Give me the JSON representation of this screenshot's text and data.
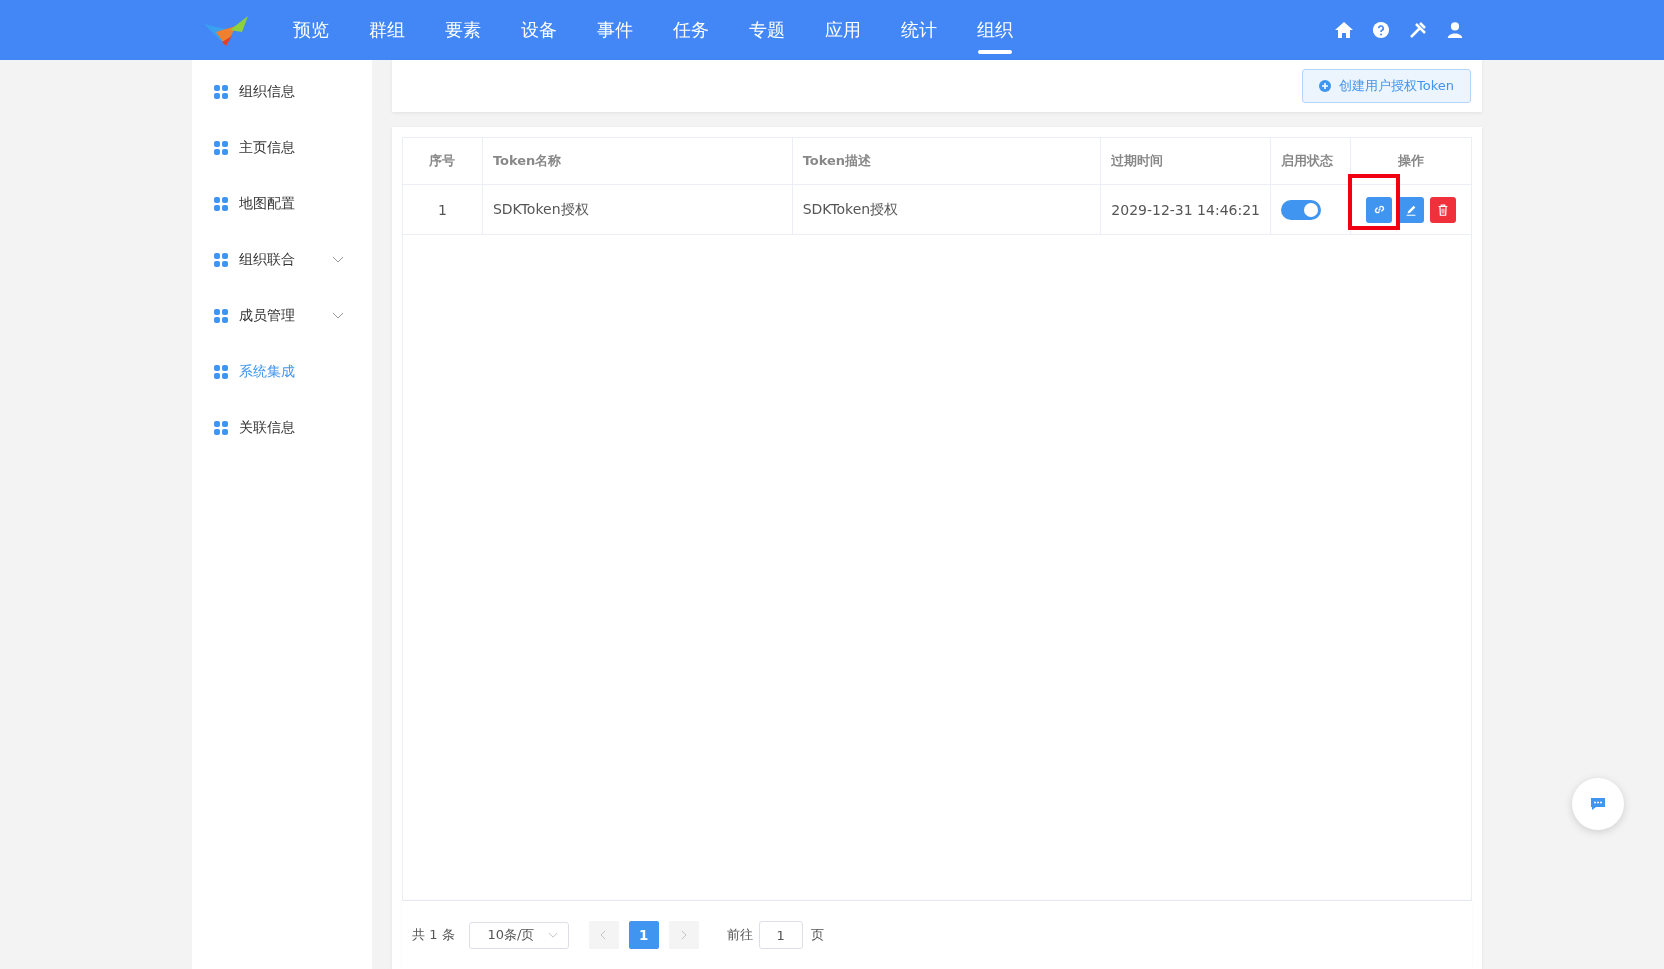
{
  "nav": {
    "tabs": [
      {
        "label": "预览",
        "selected": false
      },
      {
        "label": "群组",
        "selected": false
      },
      {
        "label": "要素",
        "selected": false
      },
      {
        "label": "设备",
        "selected": false
      },
      {
        "label": "事件",
        "selected": false
      },
      {
        "label": "任务",
        "selected": false
      },
      {
        "label": "专题",
        "selected": false
      },
      {
        "label": "应用",
        "selected": false
      },
      {
        "label": "统计",
        "selected": false
      },
      {
        "label": "组织",
        "selected": true
      }
    ]
  },
  "sidebar": {
    "items": [
      {
        "label": "组织信息",
        "selected": false,
        "expandable": false
      },
      {
        "label": "主页信息",
        "selected": false,
        "expandable": false
      },
      {
        "label": "地图配置",
        "selected": false,
        "expandable": false
      },
      {
        "label": "组织联合",
        "selected": false,
        "expandable": true
      },
      {
        "label": "成员管理",
        "selected": false,
        "expandable": true
      },
      {
        "label": "系统集成",
        "selected": true,
        "expandable": false
      },
      {
        "label": "关联信息",
        "selected": false,
        "expandable": false
      }
    ]
  },
  "toolbar": {
    "create_button": "创建用户授权Token"
  },
  "table": {
    "columns": [
      "序号",
      "Token名称",
      "Token描述",
      "过期时间",
      "启用状态",
      "操作"
    ],
    "rows": [
      {
        "index": "1",
        "name": "SDKToken授权",
        "description": "SDKToken授权",
        "expires": "2029-12-31 14:46:21",
        "enabled": true
      }
    ]
  },
  "pagination": {
    "total": "共 1 条",
    "page_size": "10条/页",
    "pages": [
      {
        "label": "1",
        "selected": true
      }
    ],
    "goto_label": "前往",
    "goto_value": "1",
    "goto_suffix": "页"
  }
}
